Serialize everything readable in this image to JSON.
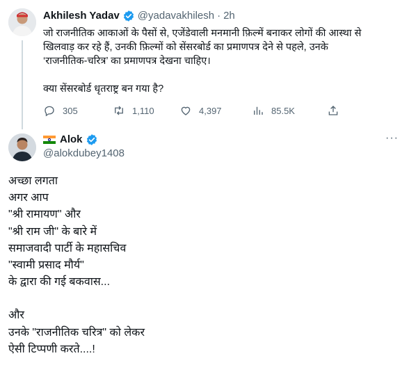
{
  "tweet1": {
    "author_name": "Akhilesh Yadav",
    "handle": "@yadavakhilesh",
    "separator": "·",
    "time": "2h",
    "text_lines": [
      "जो राजनीतिक आकाओं के पैसों से, एजेंडेवाली मनमानी फ़िल्में बनाकर लोगों की आस्था से",
      "खिलवाड़ कर रहे हैं, उनकी फ़िल्मों को सेंसरबोर्ड  का प्रमाणपत्र देने से पहले, उनके",
      "‘राजनीतिक-चरित्र’ का प्रमाणपत्र देखना चाहिए।"
    ],
    "question": "क्या सेंसरबोर्ड धृतराष्ट्र बन गया है?",
    "actions": {
      "replies": "305",
      "retweets": "1,110",
      "likes": "4,397",
      "views": "85.5K"
    }
  },
  "tweet2": {
    "author_name": "Alok",
    "handle": "@alokdubey1408",
    "more": "···",
    "text_lines": [
      "अच्छा लगता",
      "अगर आप",
      "\"श्री रामायण\" और",
      "\"श्री राम जी\" के बारे में",
      "समाजवादी पार्टी के महासचिव",
      "\"स्वामी प्रसाद मौर्य\"",
      "के द्वारा की गई बकवास...",
      "",
      "और",
      "उनके \"राजनीतिक चरित्र\" को लेकर",
      "ऐसी टिप्पणी करते....!"
    ]
  },
  "colors": {
    "verified": "#1d9bf0",
    "muted": "#536471",
    "thread_line": "#cfd9de"
  }
}
